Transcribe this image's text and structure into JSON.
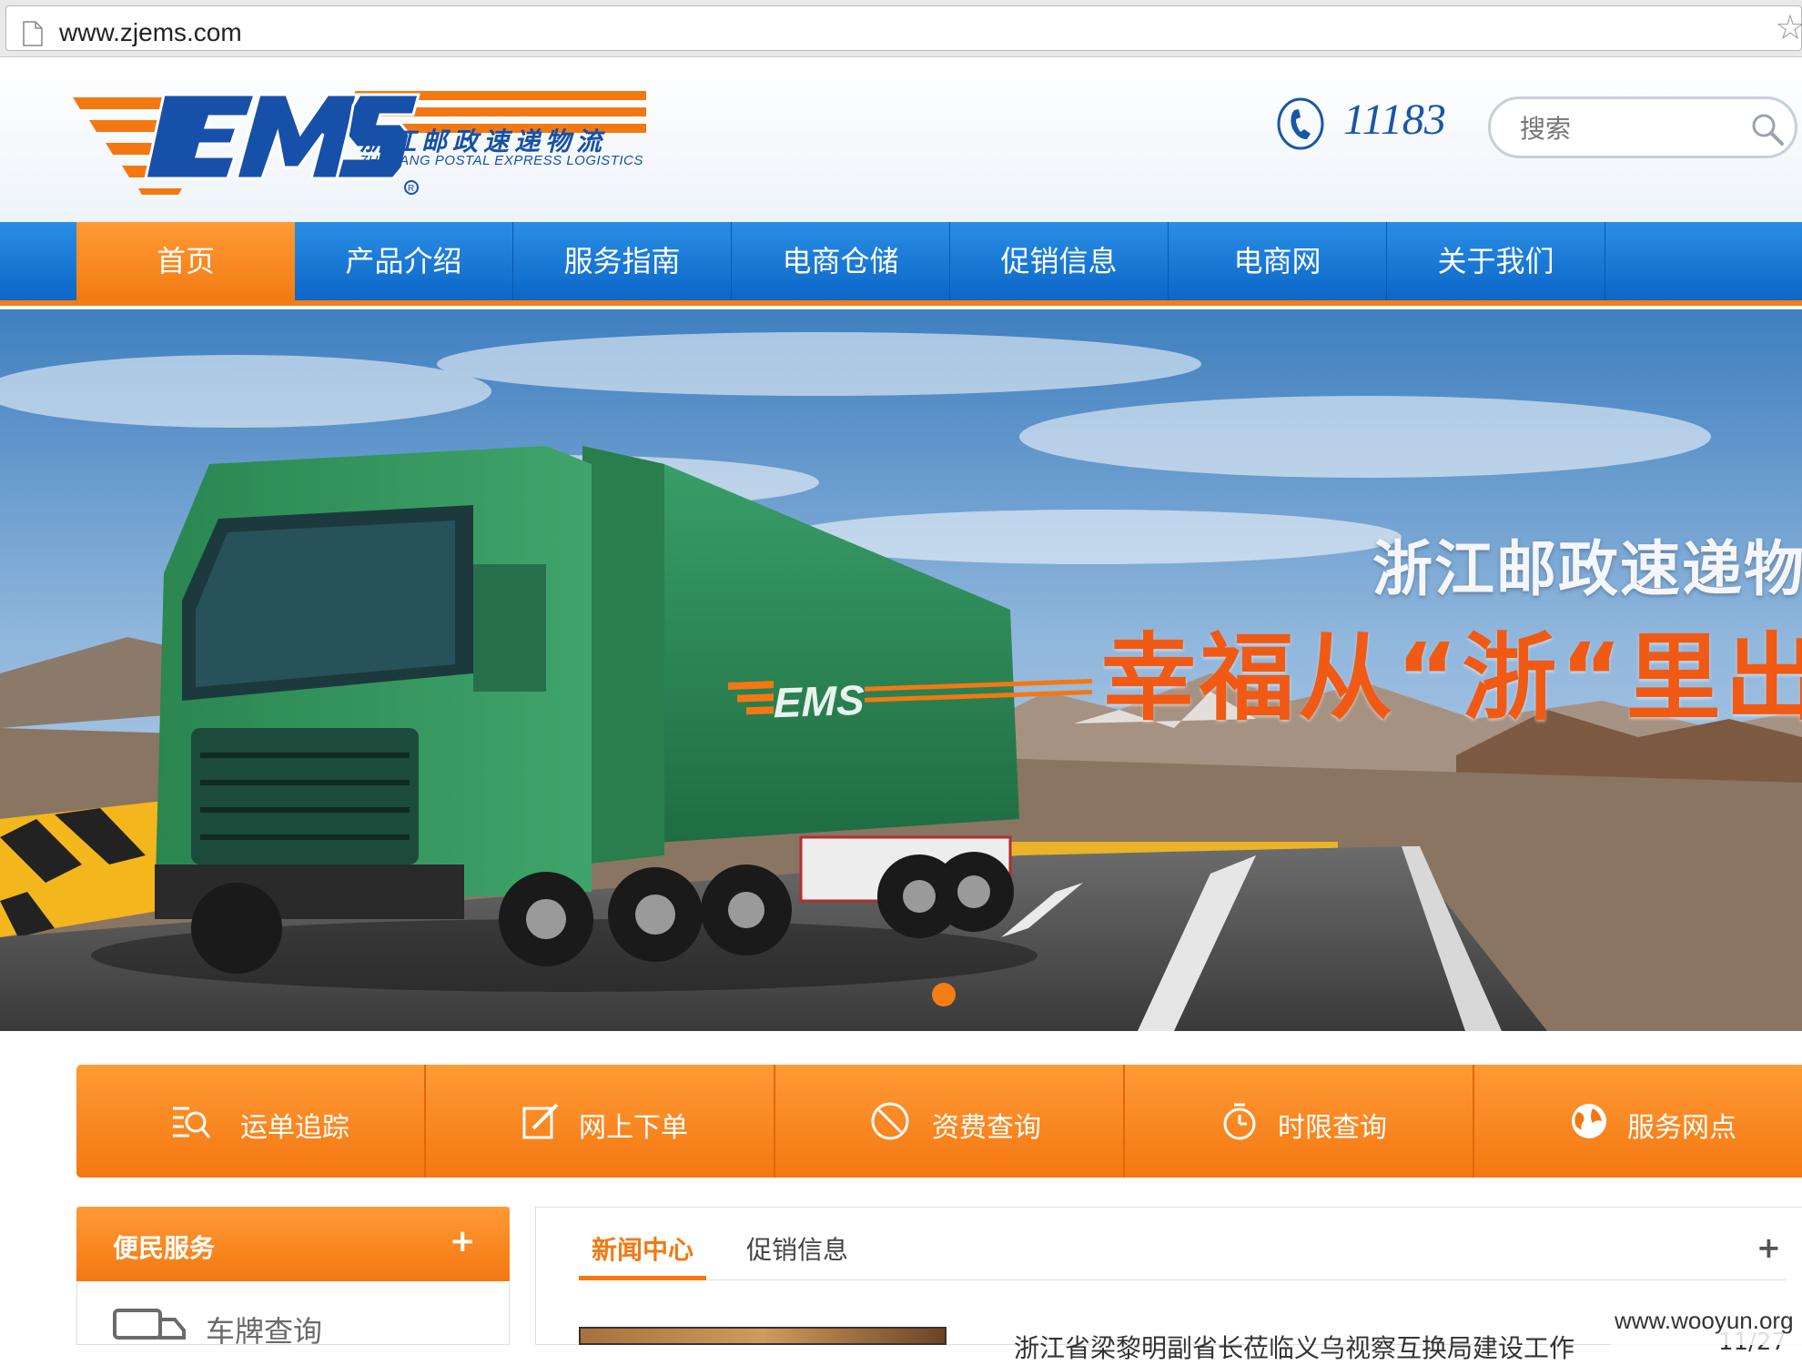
{
  "browser": {
    "url": "www.zjems.com"
  },
  "header": {
    "logo_cn": "浙江邮政速递物流",
    "logo_en": "ZHEJIANG POSTAL EXPRESS LOGISTICS",
    "phone": "11183",
    "search_placeholder": "搜索"
  },
  "nav": {
    "items": [
      "首页",
      "产品介绍",
      "服务指南",
      "电商仓储",
      "促销信息",
      "电商网",
      "关于我们"
    ],
    "active_index": 0
  },
  "banner": {
    "line1": "浙江邮政速递物流",
    "line2": "幸福从“浙“里出发"
  },
  "quick_links": [
    "运单追踪",
    "网上下单",
    "资费查询",
    "时限查询",
    "服务网点"
  ],
  "sidebar": {
    "title": "便民服务",
    "plus": "+",
    "items": [
      "车牌查询"
    ]
  },
  "news": {
    "tabs": [
      "新闻中心",
      "促销信息"
    ],
    "plus": "+",
    "headline": "浙江省梁黎明副省长莅临义乌视察互换局建设工作",
    "date": "11/27"
  },
  "watermark": "www.wooyun.org",
  "colors": {
    "orange": "#f47812",
    "blue": "#0c66c8",
    "truck_green": "#2d8a55"
  },
  "icons": [
    "page-icon",
    "star-icon",
    "phone-icon",
    "search-icon",
    "track-icon",
    "edit-icon",
    "fee-icon",
    "timer-icon",
    "globe-icon",
    "truck-icon"
  ]
}
